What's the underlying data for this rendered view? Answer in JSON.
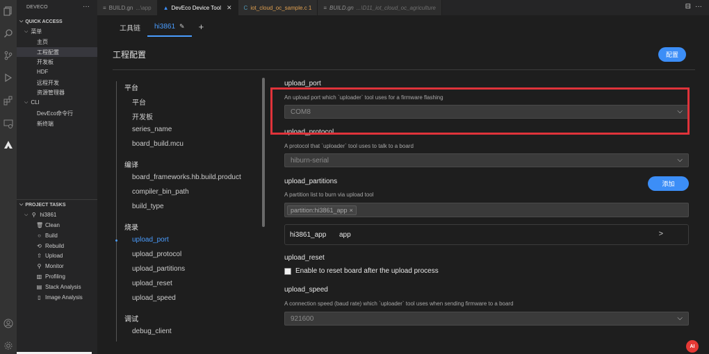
{
  "sidebar": {
    "title": "DEVECO",
    "more": "···",
    "quick_access": {
      "label": "QUICK ACCESS",
      "menu_label": "菜单",
      "items": [
        "主页",
        "工程配置",
        "开发板",
        "HDF",
        "远程开发",
        "资源管理器"
      ],
      "cli_label": "CLI",
      "cli_items": [
        "DevEco命令行",
        "新终端"
      ]
    },
    "project_tasks": {
      "label": "PROJECT TASKS",
      "project": "hi3861",
      "tasks": [
        "Clean",
        "Build",
        "Rebuild",
        "Upload",
        "Monitor",
        "Profiling",
        "Stack Analysis",
        "Image Analysis"
      ]
    }
  },
  "tabs": [
    {
      "label": "BUILD.gn",
      "path": "...\\app",
      "close": ""
    },
    {
      "label": "DevEco Device Tool",
      "path": "",
      "close": "✕"
    },
    {
      "label": "iot_cloud_oc_sample.c 1",
      "path": "",
      "close": ""
    },
    {
      "label": "BUILD.gn",
      "path": "...\\D11_iot_cloud_oc_agriculture",
      "close": ""
    }
  ],
  "editor": {
    "sub_tabs": [
      "工具链",
      "hi3861"
    ],
    "add": "+",
    "page_title": "工程配置",
    "config_button": "配置",
    "nav": {
      "groups": [
        {
          "label": "平台",
          "items": [
            "平台",
            "开发板",
            "series_name",
            "board_build.mcu"
          ]
        },
        {
          "label": "编译",
          "items": [
            "board_frameworks.hb.build.product",
            "compiler_bin_path",
            "build_type"
          ]
        },
        {
          "label": "烧录",
          "items": [
            "upload_port",
            "upload_protocol",
            "upload_partitions",
            "upload_reset",
            "upload_speed"
          ]
        },
        {
          "label": "调试",
          "items": [
            "debug_client"
          ]
        }
      ]
    },
    "upload_port": {
      "title": "upload_port",
      "desc": "An upload port which `uploader` tool uses for a firmware flashing",
      "value": "COM8"
    },
    "upload_protocol": {
      "title": "upload_protocol",
      "desc": "A protocol that `uploader` tool uses to talk to a board",
      "value": "hiburn-serial"
    },
    "upload_partitions": {
      "title": "upload_partitions",
      "desc": "A partition list to burn via upload tool",
      "add_button": "添加",
      "tag": "partition:hi3861_app",
      "tag_close": "×",
      "row_name": "hi3861_app",
      "row_type": "app",
      "row_arrow": ">"
    },
    "upload_reset": {
      "title": "upload_reset",
      "checkbox_label": "Enable to reset board after the upload process"
    },
    "upload_speed": {
      "title": "upload_speed",
      "desc": "A connection speed (baud rate) which `uploader` tool uses when sending firmware to a board",
      "value": "921600"
    }
  },
  "badge": "AI"
}
